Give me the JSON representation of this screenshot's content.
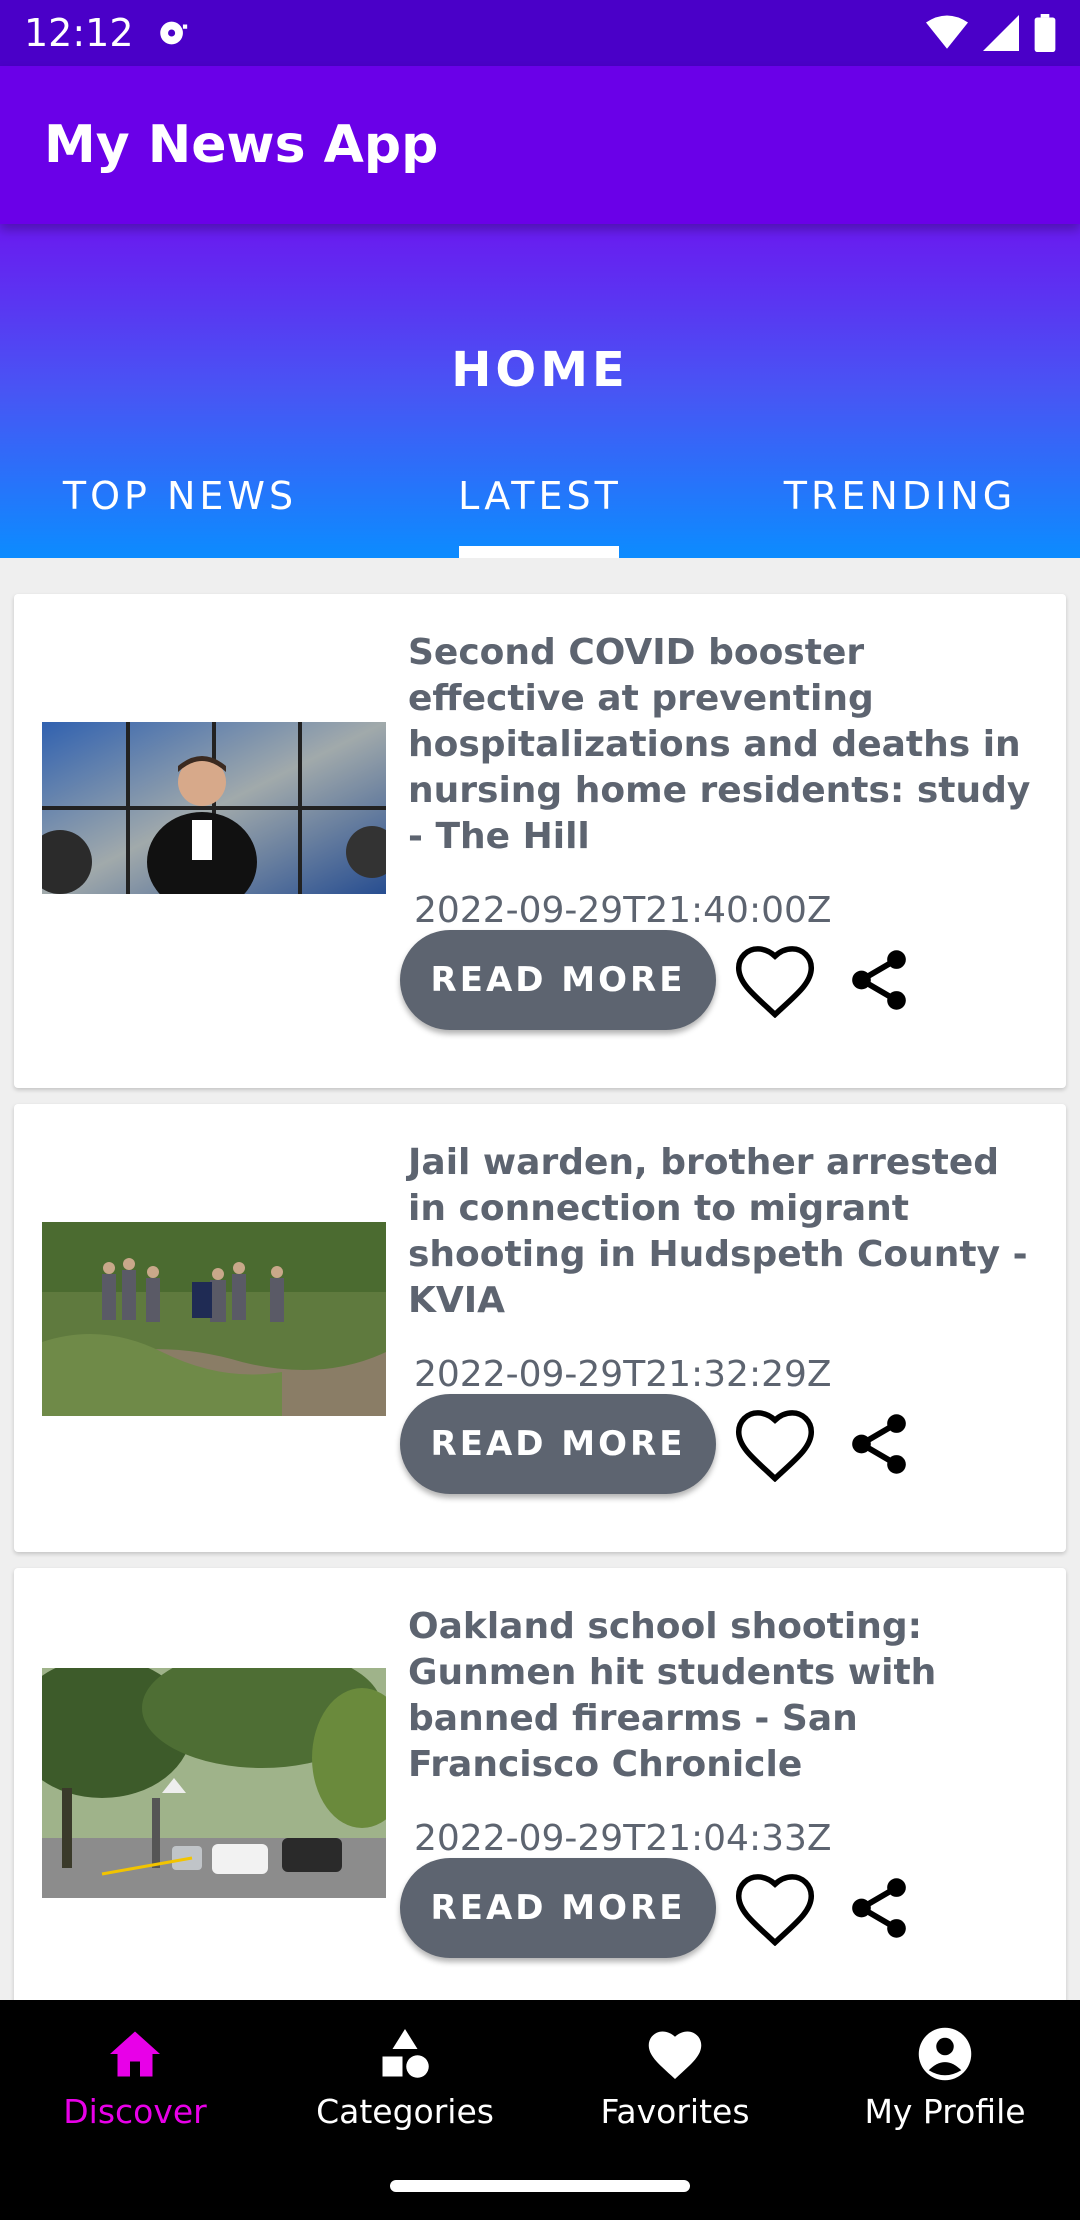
{
  "status_bar": {
    "time": "12:12"
  },
  "app_bar": {
    "title": "My News App"
  },
  "header": {
    "title": "HOME",
    "tabs": [
      {
        "label": "TOP NEWS",
        "active": false
      },
      {
        "label": "LATEST",
        "active": true
      },
      {
        "label": "TRENDING",
        "active": false
      }
    ]
  },
  "articles": [
    {
      "title": "Second COVID booster effective at preventing hospitalizations and deaths in nursing home residents: study - The Hill",
      "date": "2022-09-29T21:40:00Z",
      "read_more": "READ MORE"
    },
    {
      "title": "Jail warden, brother arrested in connection to migrant shooting in Hudspeth County - KVIA",
      "date": "2022-09-29T21:32:29Z",
      "read_more": "READ MORE"
    },
    {
      "title": "Oakland school shooting: Gunmen hit students with banned firearms - San Francisco Chronicle",
      "date": "2022-09-29T21:04:33Z",
      "read_more": "READ MORE"
    }
  ],
  "bottom_nav": [
    {
      "label": "Discover",
      "icon": "home-icon",
      "active": true
    },
    {
      "label": "Categories",
      "icon": "shapes-icon",
      "active": false
    },
    {
      "label": "Favorites",
      "icon": "heart-icon",
      "active": false
    },
    {
      "label": "My Profile",
      "icon": "account-icon",
      "active": false
    }
  ],
  "colors": {
    "status_bar": "#4a00c8",
    "app_bar": "#6a00e8",
    "accent_active_nav": "#e800e8",
    "button": "#5d6470",
    "gradient_bottom": "#0c8cff"
  }
}
